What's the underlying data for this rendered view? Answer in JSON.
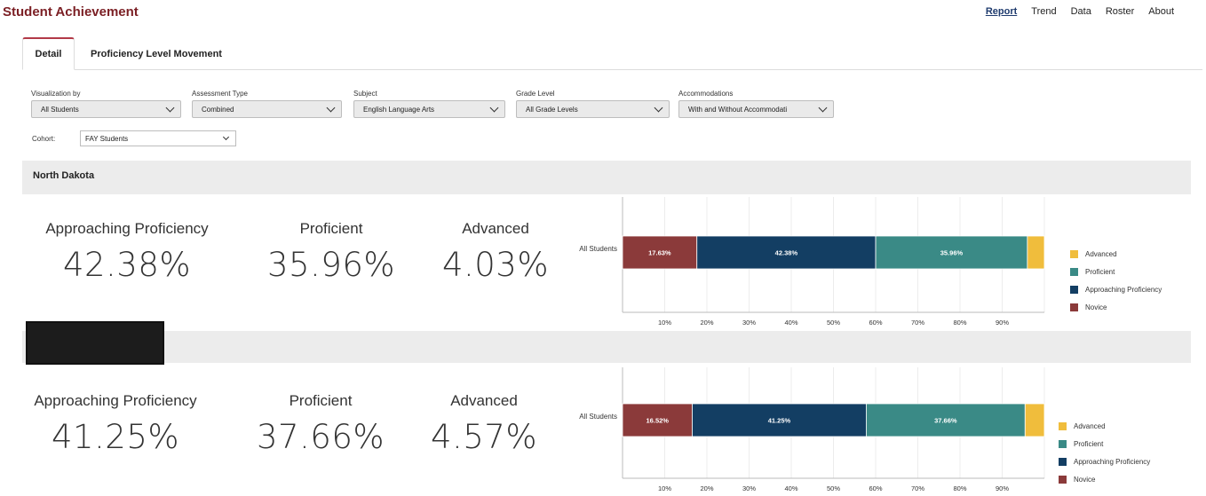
{
  "app_title": "Student Achievement",
  "nav": [
    {
      "label": "Report",
      "active": true
    },
    {
      "label": "Trend",
      "active": false
    },
    {
      "label": "Data",
      "active": false
    },
    {
      "label": "Roster",
      "active": false
    },
    {
      "label": "About",
      "active": false
    }
  ],
  "tabs": [
    {
      "label": "Detail",
      "active": true
    },
    {
      "label": "Proficiency Level Movement",
      "active": false
    }
  ],
  "filters": [
    {
      "label": "Visualization by",
      "value": "All Students"
    },
    {
      "label": "Assessment Type",
      "value": "Combined"
    },
    {
      "label": "Subject",
      "value": "English Language Arts"
    },
    {
      "label": "Grade Level",
      "value": "All Grade Levels"
    },
    {
      "label": "Accommodations",
      "value": "With and Without Accommodati"
    }
  ],
  "cohort": {
    "label": "Cohort:",
    "value": "FAY Students"
  },
  "colors": {
    "novice": "#8b3a3a",
    "approaching": "#133e63",
    "proficient": "#3a8a86",
    "advanced": "#f0bd3c",
    "brand": "#7b1f24"
  },
  "sections": [
    {
      "title": "North Dakota",
      "redacted": false,
      "metrics": [
        {
          "label": "Approaching Proficiency",
          "value": "42.38%"
        },
        {
          "label": "Proficient",
          "value": "35.96%"
        },
        {
          "label": "Advanced",
          "value": "4.03%"
        }
      ]
    },
    {
      "title": "",
      "redacted": true,
      "metrics": [
        {
          "label": "Approaching Proficiency",
          "value": "41.25%"
        },
        {
          "label": "Proficient",
          "value": "37.66%"
        },
        {
          "label": "Advanced",
          "value": "4.57%"
        }
      ]
    }
  ],
  "chart_data": [
    {
      "type": "bar",
      "orientation": "horizontal",
      "stacked": true,
      "categories": [
        "All Students"
      ],
      "series": [
        {
          "name": "Novice",
          "values": [
            17.63
          ],
          "label": "17.63%"
        },
        {
          "name": "Approaching Proficiency",
          "values": [
            42.38
          ],
          "label": "42.38%"
        },
        {
          "name": "Proficient",
          "values": [
            35.96
          ],
          "label": "35.96%"
        },
        {
          "name": "Advanced",
          "values": [
            4.03
          ],
          "label": ""
        }
      ],
      "xticks": [
        "10%",
        "20%",
        "30%",
        "40%",
        "50%",
        "60%",
        "70%",
        "80%",
        "90%"
      ],
      "xlim": [
        0,
        100
      ],
      "grid": true,
      "legend": [
        "Advanced",
        "Proficient",
        "Approaching Proficiency",
        "Novice"
      ],
      "legend_position": "right"
    },
    {
      "type": "bar",
      "orientation": "horizontal",
      "stacked": true,
      "categories": [
        "All Students"
      ],
      "series": [
        {
          "name": "Novice",
          "values": [
            16.52
          ],
          "label": "16.52%"
        },
        {
          "name": "Approaching Proficiency",
          "values": [
            41.25
          ],
          "label": "41.25%"
        },
        {
          "name": "Proficient",
          "values": [
            37.66
          ],
          "label": "37.66%"
        },
        {
          "name": "Advanced",
          "values": [
            4.57
          ],
          "label": ""
        }
      ],
      "xticks": [
        "10%",
        "20%",
        "30%",
        "40%",
        "50%",
        "60%",
        "70%",
        "80%",
        "90%"
      ],
      "xlim": [
        0,
        100
      ],
      "grid": true,
      "legend": [
        "Advanced",
        "Proficient",
        "Approaching Proficiency",
        "Novice"
      ],
      "legend_position": "right"
    }
  ]
}
